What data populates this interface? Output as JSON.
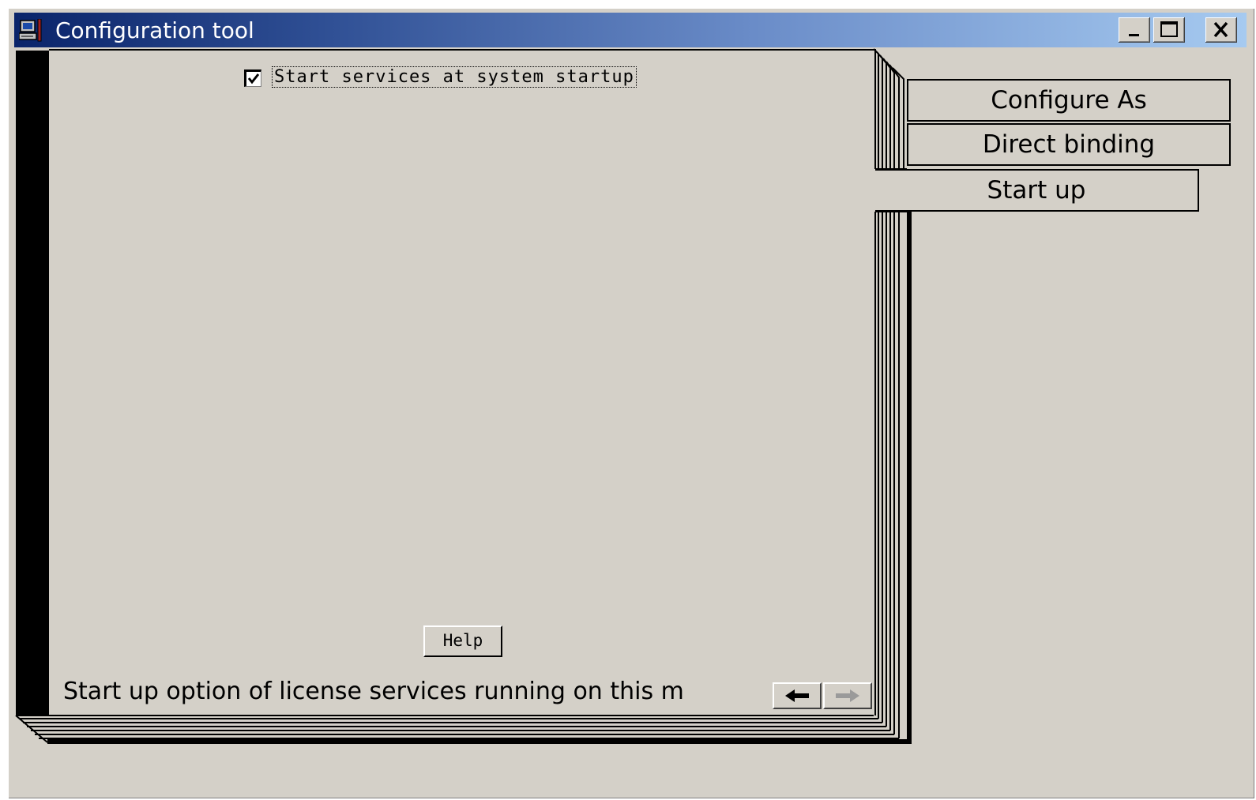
{
  "window": {
    "title": "Configuration tool",
    "icon": "computer-tools-icon",
    "controls": [
      "minimize-icon",
      "maximize-icon",
      "close-icon"
    ]
  },
  "tabs": [
    {
      "label": "Configure As",
      "active": false
    },
    {
      "label": "Direct binding",
      "active": false
    },
    {
      "label": "Start up",
      "active": true
    }
  ],
  "page": {
    "startup_checkbox": {
      "label": "Start services at system startup",
      "checked": true
    },
    "help_label": "Help",
    "status_text": "Start up option of license services running on this m",
    "nav": {
      "prev_icon": "arrow-left-icon",
      "next_icon": "arrow-right-icon"
    }
  }
}
